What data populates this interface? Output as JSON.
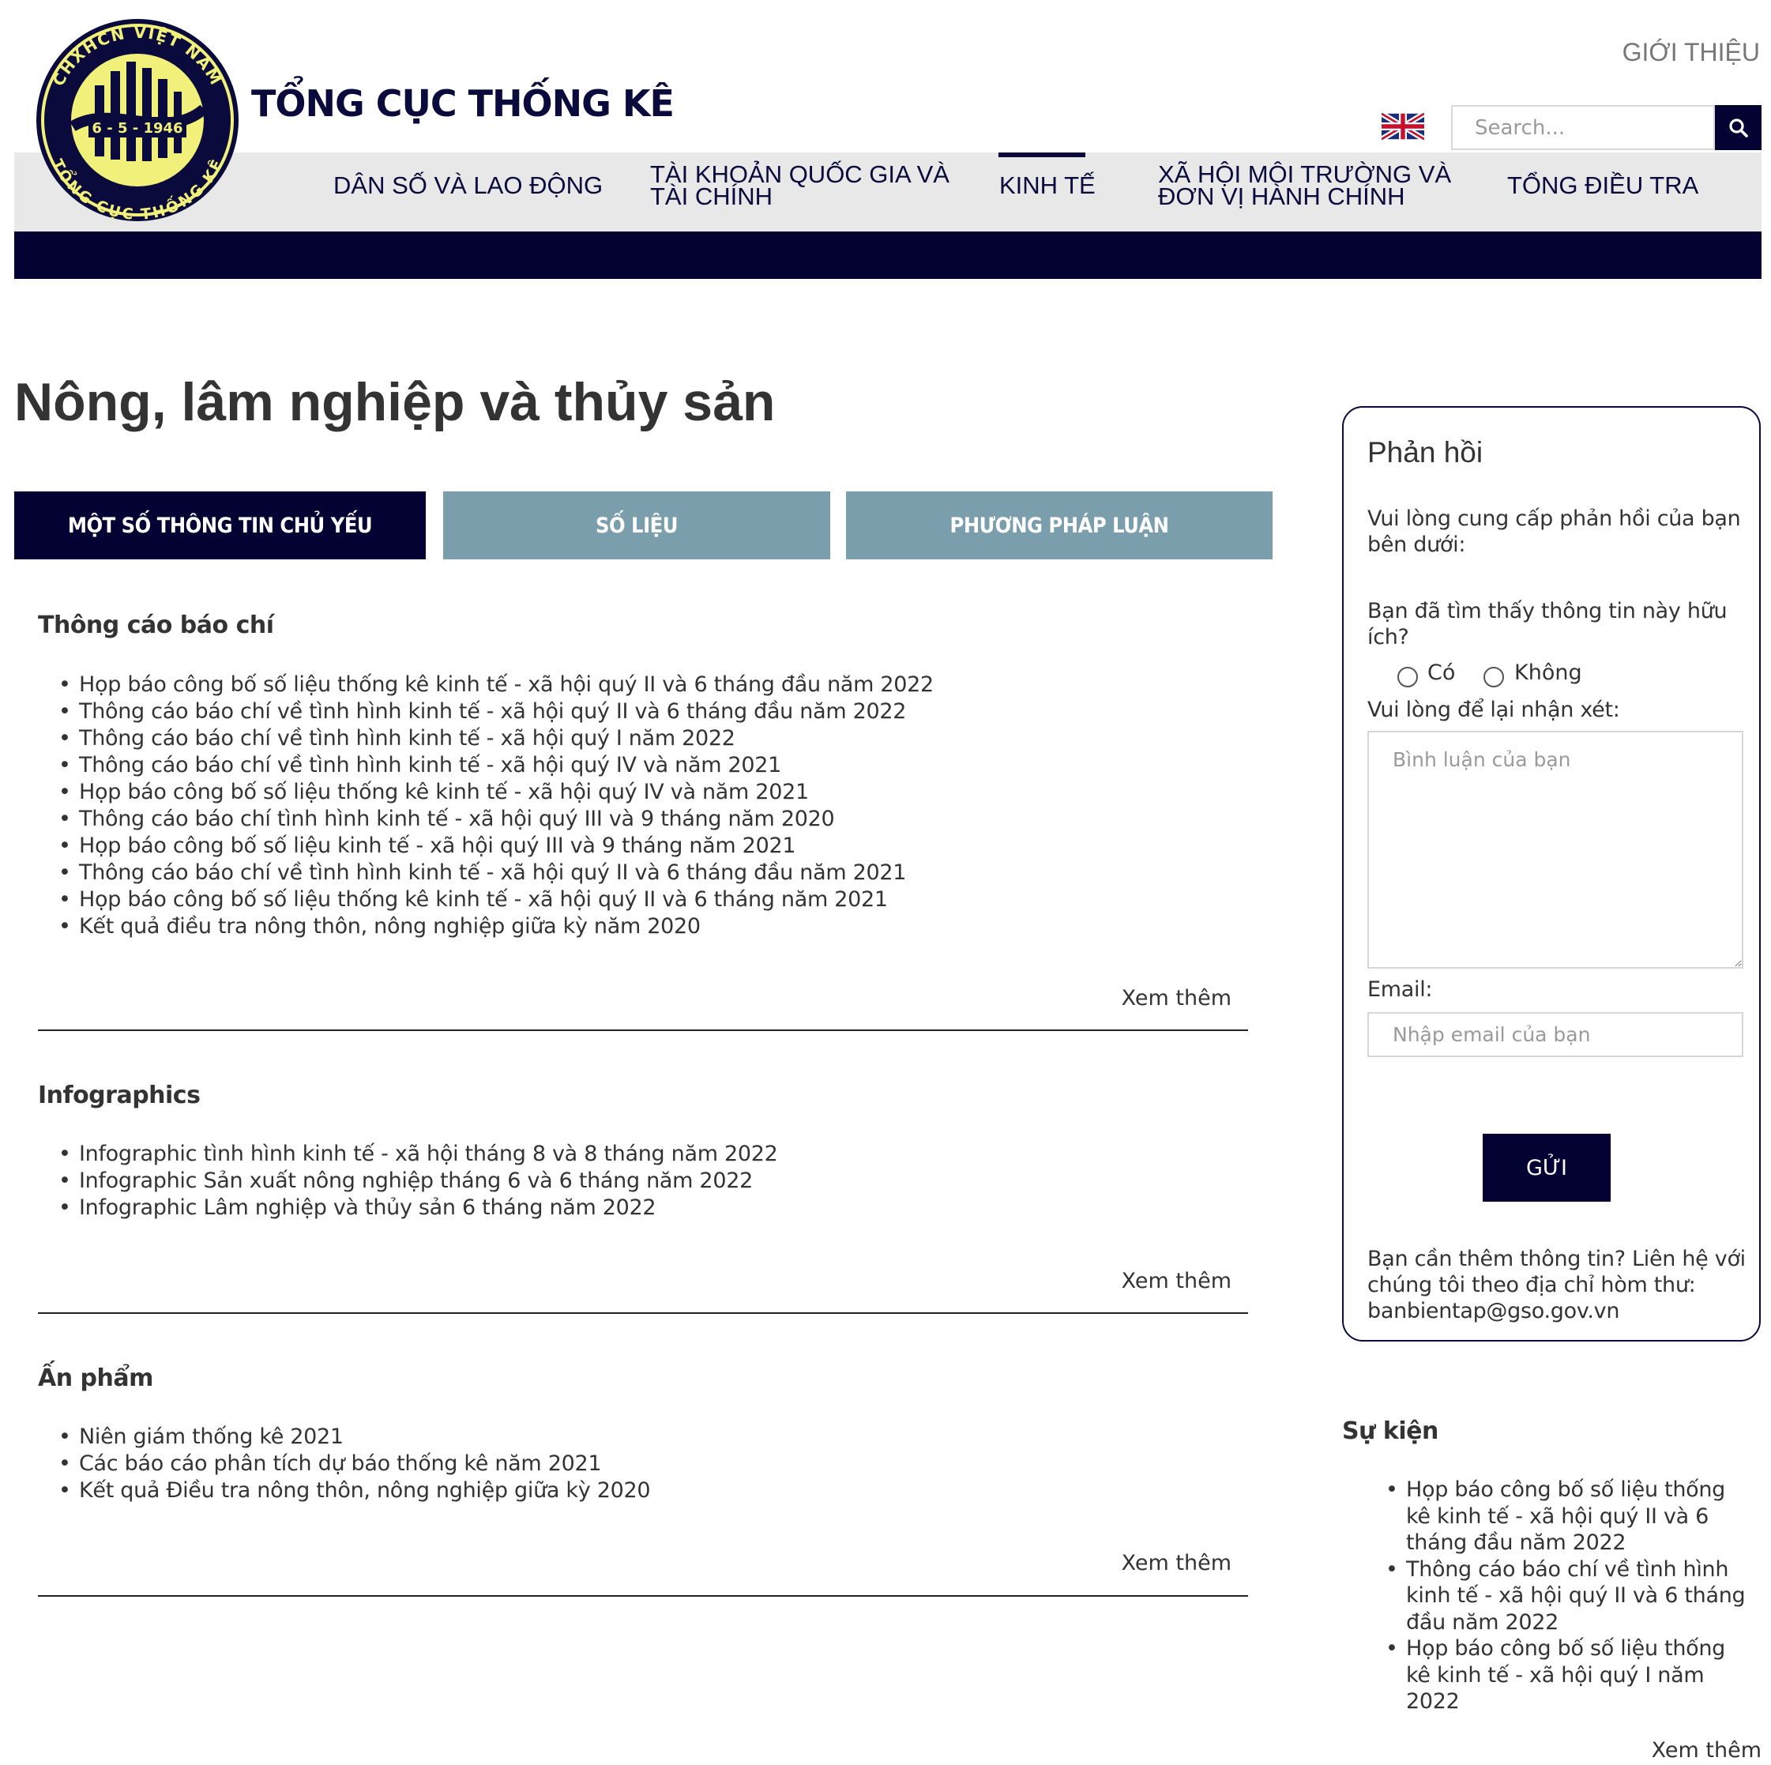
{
  "header": {
    "logo": {
      "ring_top_text": "CHXHCN VIỆT NAM",
      "ring_bottom_text": "TỔNG CỤC THỐNG KÊ",
      "date_text": "6 - 5 - 1946"
    },
    "site_title": "TỔNG CỤC THỐNG KÊ",
    "top_link": "GIỚI THIỆU",
    "search_placeholder": "Search...",
    "flag_icon": "uk-flag-icon",
    "search_icon": "search-icon",
    "colors": {
      "navy": "#040233",
      "nav_gray": "#e8e8e8",
      "tab_inactive": "#7b9eac"
    }
  },
  "nav": {
    "items": [
      {
        "line1": "DÂN SỐ VÀ LAO ĐỘNG",
        "line2": ""
      },
      {
        "line1": "TÀI KHOẢN QUỐC GIA VÀ",
        "line2": "TÀI CHÍNH"
      },
      {
        "line1": "KINH TẾ",
        "line2": "",
        "active": true
      },
      {
        "line1": "XÃ HỘI MÔI TRƯỜNG VÀ",
        "line2": "ĐƠN VỊ HÀNH CHÍNH"
      },
      {
        "line1": "TỔNG ĐIỀU TRA",
        "line2": ""
      }
    ]
  },
  "main": {
    "page_title": "Nông, lâm nghiệp và thủy sản",
    "tabs": [
      {
        "label": "MỘT SỐ THÔNG TIN CHỦ YẾU",
        "active": true
      },
      {
        "label": "SỐ LIỆU",
        "active": false
      },
      {
        "label": "PHƯƠNG PHÁP LUẬN",
        "active": false
      }
    ],
    "sections": [
      {
        "title": "Thông cáo báo chí",
        "items": [
          "Họp báo công bố số liệu thống kê kinh tế - xã hội quý II và 6 tháng đầu năm 2022",
          "Thông cáo báo chí về tình hình kinh tế - xã hội quý II và 6 tháng đầu năm 2022",
          "Thông cáo báo chí về tình hình kinh tế - xã hội quý I năm 2022",
          "Thông cáo báo chí về tình hình kinh tế - xã hội quý IV và năm 2021",
          "Họp báo công bố số liệu thống kê kinh tế - xã hội quý IV và năm 2021",
          "Thông cáo báo chí tình hình kinh tế - xã hội quý III và 9 tháng năm 2020",
          "Họp báo công bố số liệu kinh tế - xã hội quý III và 9 tháng năm 2021",
          "Thông cáo báo chí về tình hình kinh tế - xã hội quý II và 6 tháng đầu năm 2021",
          "Họp báo công bố số liệu thống kê kinh tế - xã hội quý II và 6 tháng năm 2021",
          "Kết quả điều tra nông thôn, nông nghiệp giữa kỳ năm 2020"
        ],
        "see_more": "Xem thêm"
      },
      {
        "title": "Infographics",
        "items": [
          "Infographic tình hình kinh tế - xã hội tháng 8 và 8 tháng năm 2022",
          "Infographic Sản xuất nông nghiệp tháng 6 và 6 tháng năm 2022",
          "Infographic Lâm nghiệp và thủy sản 6 tháng năm 2022"
        ],
        "see_more": "Xem thêm"
      },
      {
        "title": "Ấn phẩm",
        "items": [
          "Niên giám thống kê 2021",
          "Các báo cáo phân tích dự báo thống kê năm 2021",
          "Kết quả Điều tra nông thôn, nông nghiệp giữa kỳ 2020"
        ],
        "see_more": "Xem thêm"
      }
    ]
  },
  "sidebar": {
    "feedback": {
      "title": "Phản hồi",
      "intro": "Vui lòng cung cấp phản hồi của bạn bên dưới:",
      "question": "Bạn đã tìm thấy thông tin này hữu ích?",
      "option_yes": "Có",
      "option_no": "Không",
      "comment_label": "Vui lòng để lại nhận xét:",
      "comment_placeholder": "Bình luận của bạn",
      "email_label": "Email:",
      "email_placeholder": "Nhập email của bạn",
      "submit_label": "GỬI",
      "contact": "Bạn cần thêm thông tin? Liên hệ với chúng tôi theo địa chỉ hòm thư: banbientap@gso.gov.vn"
    },
    "events": {
      "title": "Sự kiện",
      "items": [
        "Họp báo công bố số liệu thống kê kinh tế - xã hội quý II và 6 tháng đầu năm 2022",
        "Thông cáo báo chí về tình hình kinh tế - xã hội quý II và 6 tháng đầu năm 2022",
        "Họp báo công bố số liệu thống kê kinh tế - xã hội quý I năm 2022"
      ],
      "see_more": "Xem thêm"
    }
  }
}
